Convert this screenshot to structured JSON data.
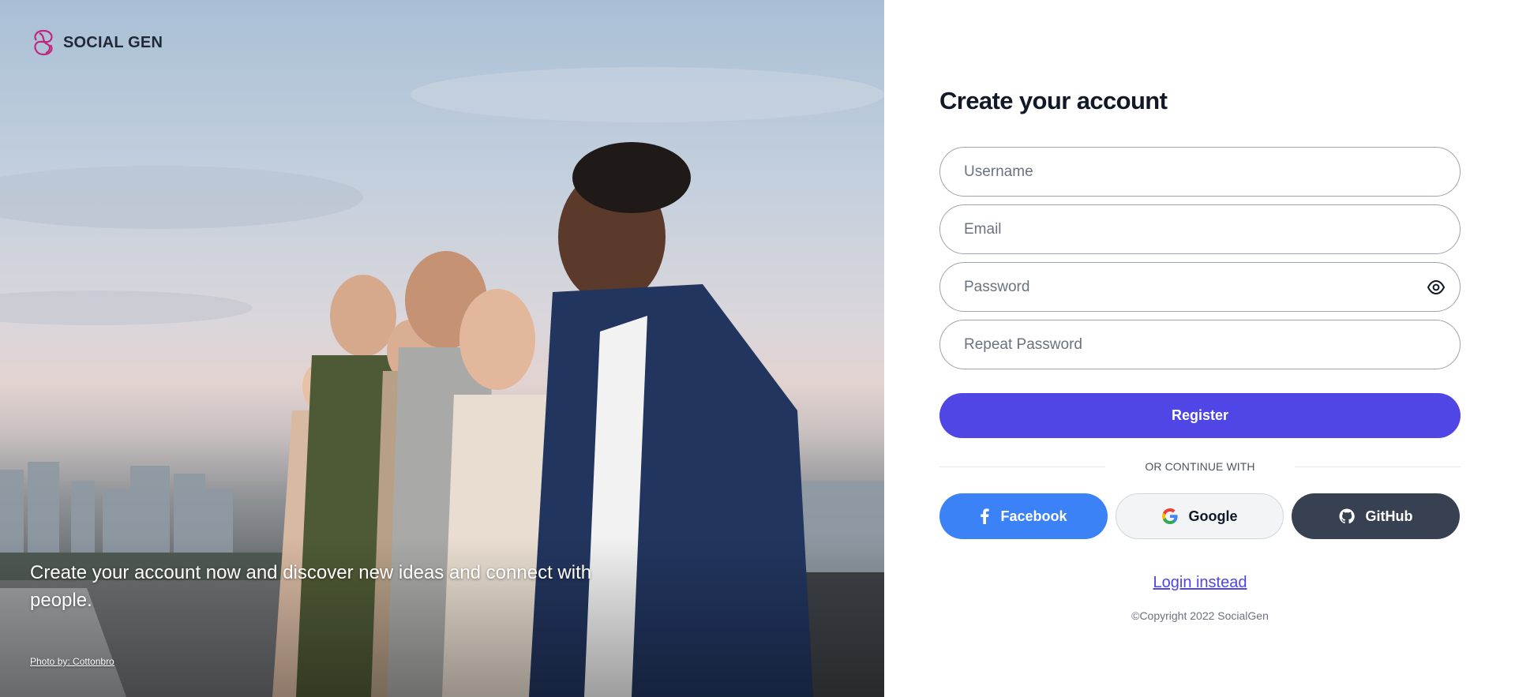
{
  "brand": {
    "name": "SOCIAL GEN"
  },
  "hero": {
    "caption": "Create your account now and discover new ideas and connect with people.",
    "photo_credit": "Photo by: Cottonbro"
  },
  "form": {
    "title": "Create your account",
    "username_placeholder": "Username",
    "email_placeholder": "Email",
    "password_placeholder": "Password",
    "repeat_password_placeholder": "Repeat Password",
    "register_label": "Register",
    "divider_text": "OR CONTINUE WITH",
    "socials": {
      "facebook": "Facebook",
      "google": "Google",
      "github": "GitHub"
    },
    "login_link": "Login instead",
    "copyright": "©Copyright 2022 SocialGen"
  },
  "colors": {
    "primary": "#4f46e5",
    "facebook": "#3b82f6",
    "github": "#374151",
    "brand_mark": "#c0267d"
  },
  "icons": [
    "socialgen-logo-icon",
    "eye-icon",
    "facebook-icon",
    "google-icon",
    "github-icon"
  ]
}
